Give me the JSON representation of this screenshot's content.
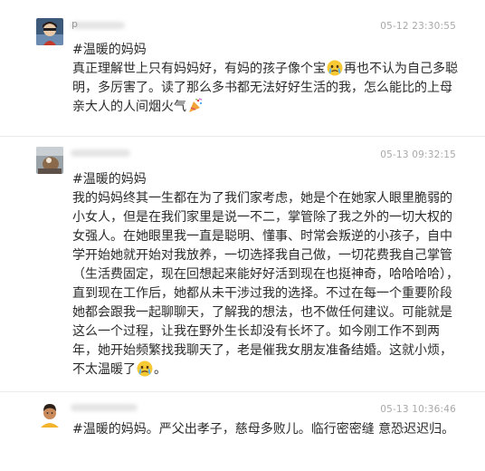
{
  "comments": [
    {
      "username_fragment": "p",
      "timestamp": "05-12 23:30:55",
      "hashtag": "#温暖的妈妈",
      "text_parts": [
        "真正理解世上只有妈妈好，有妈的孩子像个宝",
        "再也不认为自己多聪明，多厉害了。读了那么多书都无法好好生活的我，怎么能比的上母亲大人的人间烟火气"
      ],
      "emojis": [
        "crying-face-emoji",
        "party-popper-emoji"
      ]
    },
    {
      "username_fragment": "",
      "timestamp": "05-13 09:32:15",
      "hashtag": "#温暖的妈妈",
      "text_parts": [
        "我的妈妈终其一生都在为了我们家考虑，她是个在她家人眼里脆弱的小女人，但是在我们家里是说一不二，掌管除了我之外的一切大权的女强人。在她眼里我一直是聪明、懂事、时常会叛逆的小孩子，自中学开始她就开始对我放养，一切选择我自己做，一切花费我自己掌管（生活费固定，现在回想起来能好好活到现在也挺神奇，哈哈哈哈），直到现在工作后，她都从未干涉过我的选择。不过在每一个重要阶段她都会跟我一起聊聊天，了解我的想法，也不做任何建议。可能就是这么一个过程，让我在野外生长却没有长坏了。如今刚工作不到两年，她开始频繁找我聊天了，老是催我女朋友准备结婚。这就小烦，不太温暖了",
        "。"
      ],
      "emojis": [
        "crying-face-emoji"
      ]
    },
    {
      "username_fragment": "",
      "timestamp": "05-13 10:36:46",
      "hashtag": "#温暖的妈妈。",
      "text_parts": [
        "严父出孝子，慈母多败儿。临行密密缝 意恐迟迟归。"
      ],
      "emojis": []
    }
  ]
}
